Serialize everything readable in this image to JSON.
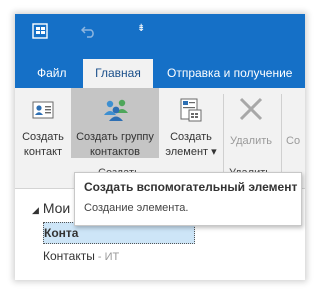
{
  "colors": {
    "accent": "#1570c7",
    "ribbon_bg": "#f2f2f2",
    "pressed": "#c5c5c5",
    "selection": "#cde5f7"
  },
  "quick_access": {
    "icons": [
      "outlook-app-icon",
      "undo-icon",
      "customize-qat-icon"
    ],
    "more_glyph": "⇟"
  },
  "tabs": [
    {
      "label": "Файл",
      "active": false
    },
    {
      "label": "Главная",
      "active": true
    },
    {
      "label": "Отправка и получение",
      "active": false
    }
  ],
  "ribbon": {
    "new_contact": {
      "line1": "Создать",
      "line2": "контакт",
      "icon": "contact-card-icon"
    },
    "new_group": {
      "line1": "Создать группу",
      "line2": "контактов",
      "icon": "contact-group-icon"
    },
    "new_item": {
      "line1": "Создать",
      "line2": "элемент ▾",
      "icon": "new-items-icon"
    },
    "group_create_label": "Создать",
    "delete": {
      "label": "Удалить",
      "icon": "delete-x-icon"
    },
    "group_delete_label": "Удалить",
    "extra": {
      "label": "Со"
    }
  },
  "nav": {
    "header_arrow": "◢",
    "header": "Мои",
    "selected_item": "Конта",
    "contacts_item": "Контакты",
    "contacts_suffix": " - ИТ"
  },
  "tooltip": {
    "title": "Создать вспомогательный элемент",
    "description": "Создание элемента."
  }
}
